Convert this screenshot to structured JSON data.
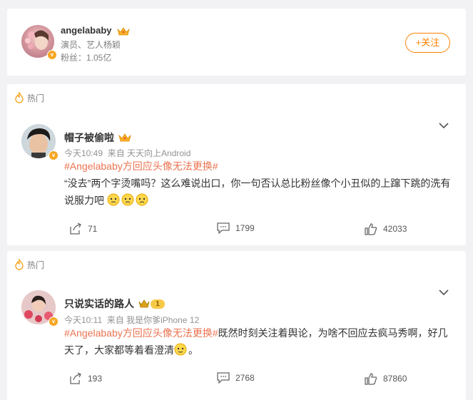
{
  "profile": {
    "name": "angelababy",
    "description": "演员、艺人杨颖",
    "fans": "粉丝：1.05亿",
    "follow_label": "+关注"
  },
  "posts": [
    {
      "hot_label": "热门",
      "username": "帽子被偷啦",
      "meta": "今天10:49  来自 天天向上Android",
      "topic": "#Angelababy方回应头像无法更换#",
      "text": "“没去”两个字烫嘴吗？这么难说出口，你一句否认总比粉丝像个小丑似的上蹿下跳的洗有说服力吧",
      "shares": "71",
      "comments": "1799",
      "likes": "42033"
    },
    {
      "hot_label": "热门",
      "username": "只说实话的路人",
      "level": "1",
      "meta": "今天10:11  来自 我是你爹iPhone 12",
      "topic": "#Angelababy方回应头像无法更换#",
      "text": "既然时刻关注着舆论，为啥不回应去疯马秀啊，好几天了，大家都等着看澄清",
      "text_end": "。",
      "shares": "193",
      "comments": "2768",
      "likes": "87860"
    }
  ],
  "icons": {
    "hot": "hot-icon",
    "share": "share-icon",
    "comment": "comment-icon",
    "like": "like-icon",
    "chevron": "chevron-down-icon",
    "crown": "crown-icon",
    "verified": "verified-badge-icon",
    "emoji": "emoji-icon"
  },
  "colors": {
    "accent": "#ff8200",
    "topic": "#eb7350",
    "badge": "#f6a623"
  }
}
